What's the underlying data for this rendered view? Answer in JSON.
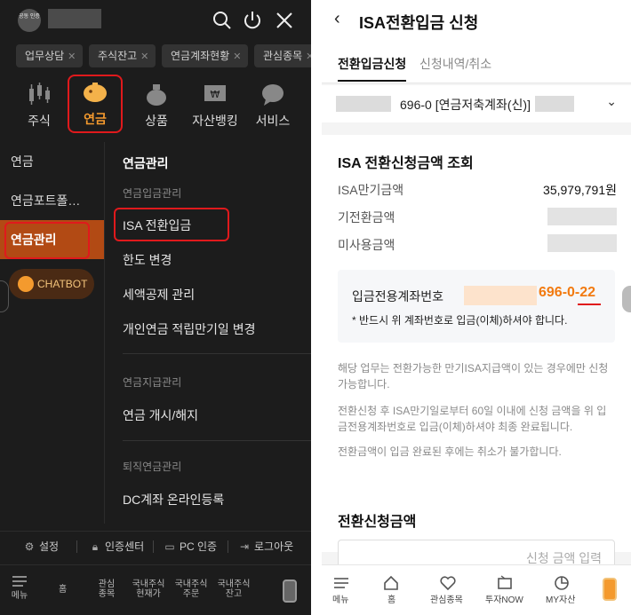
{
  "left": {
    "logo_text": "공동 인증",
    "tags": [
      "업무상담",
      "주식잔고",
      "연금계좌현황",
      "관심종목"
    ],
    "categories": [
      {
        "label": "주식",
        "icon": "candlestick-icon"
      },
      {
        "label": "연금",
        "icon": "piggy-bank-icon"
      },
      {
        "label": "상품",
        "icon": "money-bag-icon"
      },
      {
        "label": "자산뱅킹",
        "icon": "banking-icon"
      },
      {
        "label": "서비스",
        "icon": "chat-bubble-icon"
      }
    ],
    "side_menu": [
      "연금",
      "연금포트폴…",
      "연금관리"
    ],
    "chatbot": "CHATBOT",
    "submenu": {
      "title": "연금관리",
      "group1": "연금입금관리",
      "items1": [
        "ISA 전환입금",
        "한도 변경",
        "세액공제 관리",
        "개인연금 적립만기일 변경"
      ],
      "group2": "연금지급관리",
      "items2": [
        "연금 개시/해지"
      ],
      "group3": "퇴직연금관리",
      "items3": [
        "DC계좌 온라인등록"
      ]
    },
    "settings": [
      "설정",
      "인증센터",
      "PC 인증",
      "로그아웃"
    ],
    "bottom_nav": [
      "메뉴",
      "홈",
      "관심\n종목",
      "국내주식\n현재가",
      "국내주식\n주문",
      "국내주식\n잔고"
    ]
  },
  "right": {
    "title": "ISA전환입금 신청",
    "tabs": [
      "전환입금신청",
      "신청내역/취소"
    ],
    "account": "696-0 [연금저축계좌(신)]",
    "section1": "ISA 전환신청금액 조회",
    "rows": [
      {
        "label": "ISA만기금액",
        "value": "35,979,791원"
      },
      {
        "label": "기전환금액",
        "value": ""
      },
      {
        "label": "미사용금액",
        "value": ""
      }
    ],
    "info_label": "입금전용계좌번호",
    "info_number": "696-0-22",
    "info_warn": "* 반드시 위 계좌번호로 입금(이체)하셔야 합니다.",
    "notes": [
      "해당 업무는 전환가능한 만기ISA지급액이 있는 경우에만 신청 가능합니다.",
      "전환신청 후 ISA만기일로부터 60일 이내에 신청 금액을 위 입금전용계좌번호로 입금(이체)하셔야 최종 완료됩니다.",
      "전환금액이 입금 완료된 후에는 취소가 불가합니다."
    ],
    "section2": "전환신청금액",
    "amount_placeholder": "신청 금액 입력",
    "bottom_nav": [
      "메뉴",
      "홈",
      "관심종목",
      "투자NOW",
      "MY자산"
    ]
  },
  "colors": {
    "accent": "#f49a2e",
    "highlight_red": "#e0191c",
    "active_menu_bg": "#b24a14",
    "account_number": "#f27a10"
  }
}
